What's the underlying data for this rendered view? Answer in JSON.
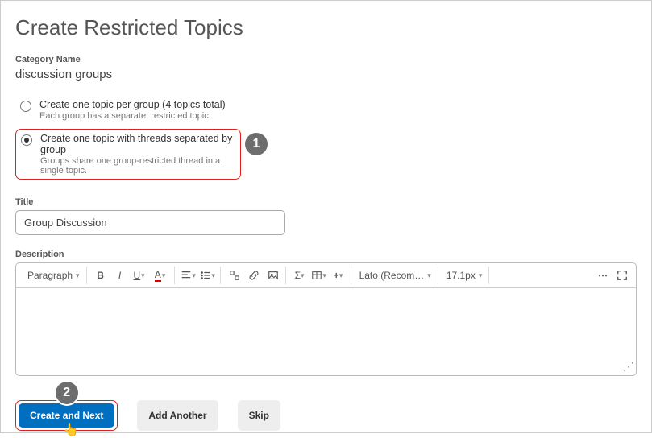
{
  "page_title": "Create Restricted Topics",
  "category_label": "Category Name",
  "category_value": "discussion groups",
  "options": [
    {
      "label": "Create one topic per group (4 topics total)",
      "sublabel": "Each group has a separate, restricted topic.",
      "checked": false
    },
    {
      "label": "Create one topic with threads separated by group",
      "sublabel": "Groups share one group-restricted thread in a single topic.",
      "checked": true
    }
  ],
  "title_label": "Title",
  "title_value": "Group Discussion",
  "description_label": "Description",
  "toolbar": {
    "format": "Paragraph",
    "font": "Lato (Recom…",
    "size": "17.1px"
  },
  "buttons": {
    "primary": "Create and Next",
    "add_another": "Add Another",
    "skip": "Skip"
  },
  "annotations": {
    "a1": "1",
    "a2": "2"
  }
}
